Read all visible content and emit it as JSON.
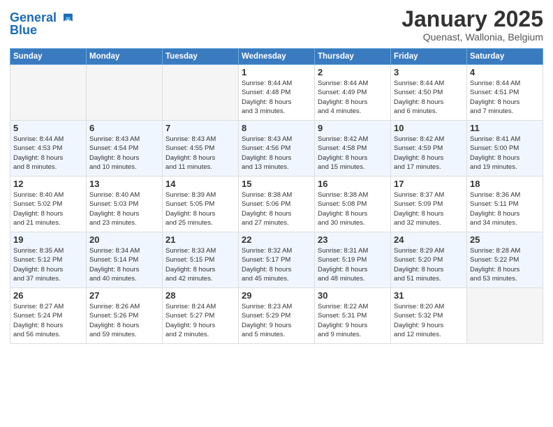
{
  "header": {
    "logo_line1": "General",
    "logo_line2": "Blue",
    "month_title": "January 2025",
    "location": "Quenast, Wallonia, Belgium"
  },
  "weekdays": [
    "Sunday",
    "Monday",
    "Tuesday",
    "Wednesday",
    "Thursday",
    "Friday",
    "Saturday"
  ],
  "weeks": [
    [
      {
        "day": "",
        "info": ""
      },
      {
        "day": "",
        "info": ""
      },
      {
        "day": "",
        "info": ""
      },
      {
        "day": "1",
        "info": "Sunrise: 8:44 AM\nSunset: 4:48 PM\nDaylight: 8 hours\nand 3 minutes."
      },
      {
        "day": "2",
        "info": "Sunrise: 8:44 AM\nSunset: 4:49 PM\nDaylight: 8 hours\nand 4 minutes."
      },
      {
        "day": "3",
        "info": "Sunrise: 8:44 AM\nSunset: 4:50 PM\nDaylight: 8 hours\nand 6 minutes."
      },
      {
        "day": "4",
        "info": "Sunrise: 8:44 AM\nSunset: 4:51 PM\nDaylight: 8 hours\nand 7 minutes."
      }
    ],
    [
      {
        "day": "5",
        "info": "Sunrise: 8:44 AM\nSunset: 4:53 PM\nDaylight: 8 hours\nand 8 minutes."
      },
      {
        "day": "6",
        "info": "Sunrise: 8:43 AM\nSunset: 4:54 PM\nDaylight: 8 hours\nand 10 minutes."
      },
      {
        "day": "7",
        "info": "Sunrise: 8:43 AM\nSunset: 4:55 PM\nDaylight: 8 hours\nand 11 minutes."
      },
      {
        "day": "8",
        "info": "Sunrise: 8:43 AM\nSunset: 4:56 PM\nDaylight: 8 hours\nand 13 minutes."
      },
      {
        "day": "9",
        "info": "Sunrise: 8:42 AM\nSunset: 4:58 PM\nDaylight: 8 hours\nand 15 minutes."
      },
      {
        "day": "10",
        "info": "Sunrise: 8:42 AM\nSunset: 4:59 PM\nDaylight: 8 hours\nand 17 minutes."
      },
      {
        "day": "11",
        "info": "Sunrise: 8:41 AM\nSunset: 5:00 PM\nDaylight: 8 hours\nand 19 minutes."
      }
    ],
    [
      {
        "day": "12",
        "info": "Sunrise: 8:40 AM\nSunset: 5:02 PM\nDaylight: 8 hours\nand 21 minutes."
      },
      {
        "day": "13",
        "info": "Sunrise: 8:40 AM\nSunset: 5:03 PM\nDaylight: 8 hours\nand 23 minutes."
      },
      {
        "day": "14",
        "info": "Sunrise: 8:39 AM\nSunset: 5:05 PM\nDaylight: 8 hours\nand 25 minutes."
      },
      {
        "day": "15",
        "info": "Sunrise: 8:38 AM\nSunset: 5:06 PM\nDaylight: 8 hours\nand 27 minutes."
      },
      {
        "day": "16",
        "info": "Sunrise: 8:38 AM\nSunset: 5:08 PM\nDaylight: 8 hours\nand 30 minutes."
      },
      {
        "day": "17",
        "info": "Sunrise: 8:37 AM\nSunset: 5:09 PM\nDaylight: 8 hours\nand 32 minutes."
      },
      {
        "day": "18",
        "info": "Sunrise: 8:36 AM\nSunset: 5:11 PM\nDaylight: 8 hours\nand 34 minutes."
      }
    ],
    [
      {
        "day": "19",
        "info": "Sunrise: 8:35 AM\nSunset: 5:12 PM\nDaylight: 8 hours\nand 37 minutes."
      },
      {
        "day": "20",
        "info": "Sunrise: 8:34 AM\nSunset: 5:14 PM\nDaylight: 8 hours\nand 40 minutes."
      },
      {
        "day": "21",
        "info": "Sunrise: 8:33 AM\nSunset: 5:15 PM\nDaylight: 8 hours\nand 42 minutes."
      },
      {
        "day": "22",
        "info": "Sunrise: 8:32 AM\nSunset: 5:17 PM\nDaylight: 8 hours\nand 45 minutes."
      },
      {
        "day": "23",
        "info": "Sunrise: 8:31 AM\nSunset: 5:19 PM\nDaylight: 8 hours\nand 48 minutes."
      },
      {
        "day": "24",
        "info": "Sunrise: 8:29 AM\nSunset: 5:20 PM\nDaylight: 8 hours\nand 51 minutes."
      },
      {
        "day": "25",
        "info": "Sunrise: 8:28 AM\nSunset: 5:22 PM\nDaylight: 8 hours\nand 53 minutes."
      }
    ],
    [
      {
        "day": "26",
        "info": "Sunrise: 8:27 AM\nSunset: 5:24 PM\nDaylight: 8 hours\nand 56 minutes."
      },
      {
        "day": "27",
        "info": "Sunrise: 8:26 AM\nSunset: 5:26 PM\nDaylight: 8 hours\nand 59 minutes."
      },
      {
        "day": "28",
        "info": "Sunrise: 8:24 AM\nSunset: 5:27 PM\nDaylight: 9 hours\nand 2 minutes."
      },
      {
        "day": "29",
        "info": "Sunrise: 8:23 AM\nSunset: 5:29 PM\nDaylight: 9 hours\nand 5 minutes."
      },
      {
        "day": "30",
        "info": "Sunrise: 8:22 AM\nSunset: 5:31 PM\nDaylight: 9 hours\nand 9 minutes."
      },
      {
        "day": "31",
        "info": "Sunrise: 8:20 AM\nSunset: 5:32 PM\nDaylight: 9 hours\nand 12 minutes."
      },
      {
        "day": "",
        "info": ""
      }
    ]
  ]
}
